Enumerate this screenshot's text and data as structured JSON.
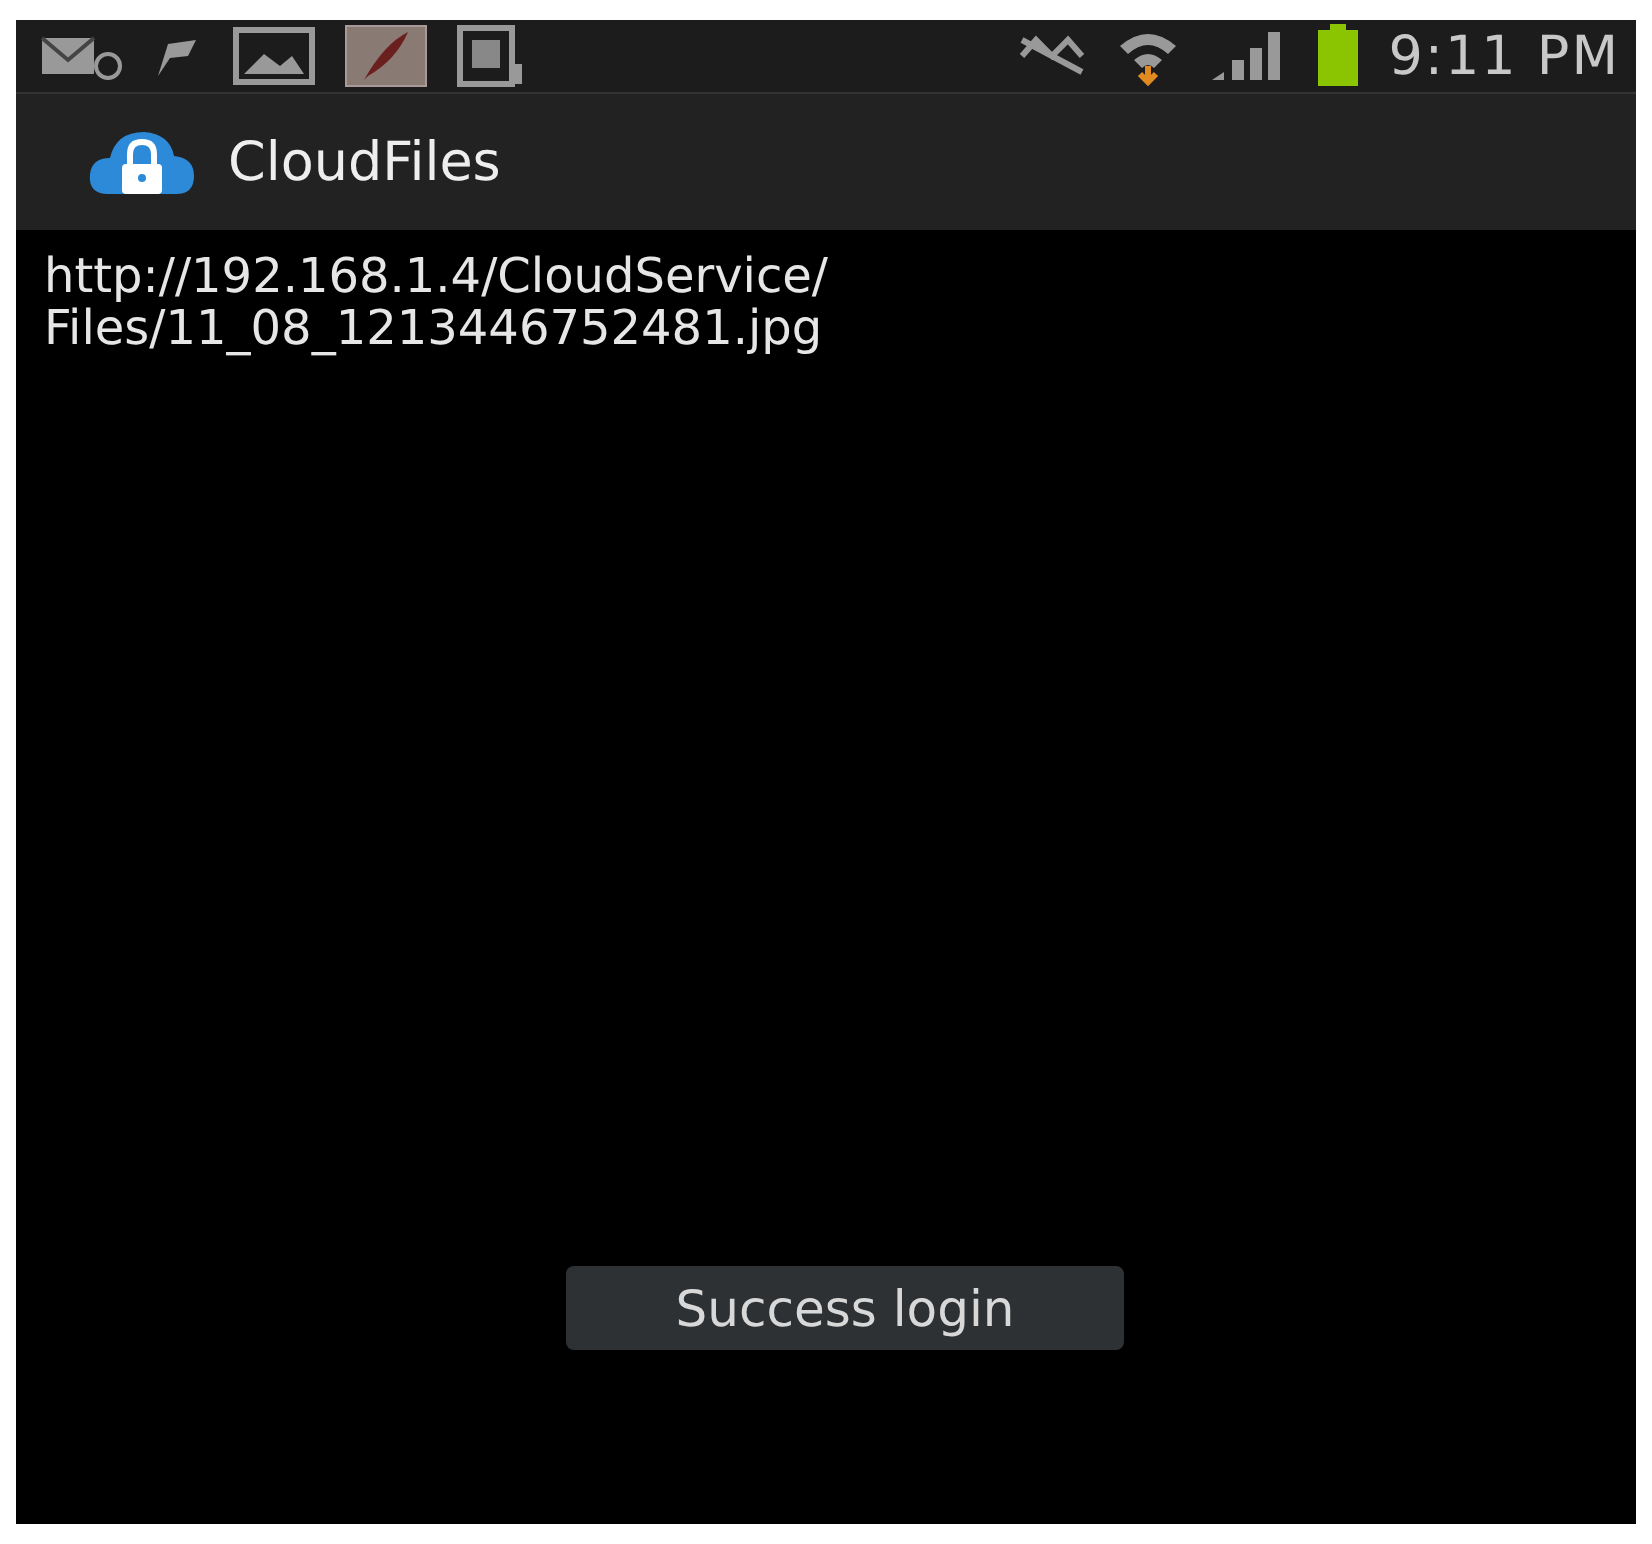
{
  "status_bar": {
    "time": "9:11 PM"
  },
  "action_bar": {
    "title": "CloudFiles"
  },
  "content": {
    "lines": [
      "http://192.168.1.4/CloudService/",
      "Files/11_08_1213446752481.jpg"
    ]
  },
  "toast": {
    "text": "Success login"
  }
}
